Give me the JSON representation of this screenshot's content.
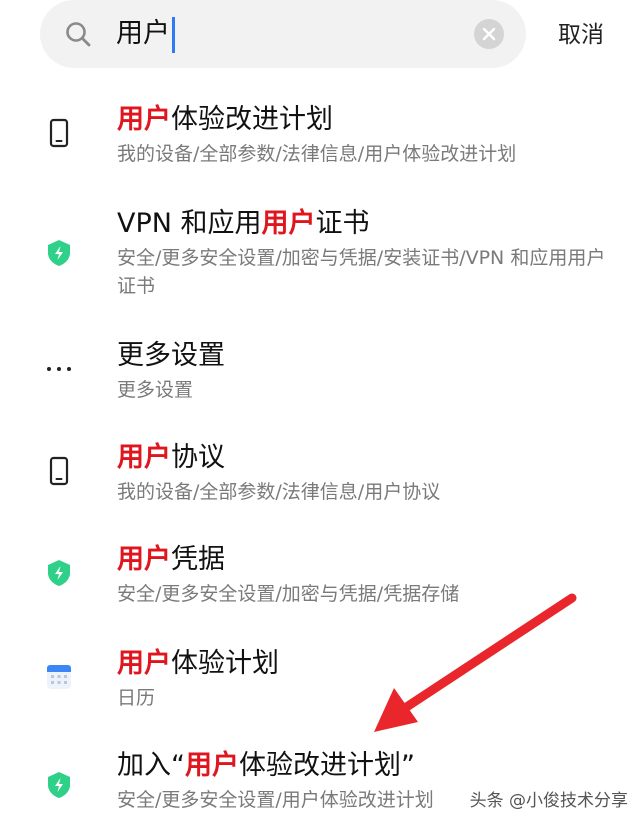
{
  "search": {
    "query": "用户",
    "cancel_label": "取消"
  },
  "results": [
    {
      "icon": "phone-icon",
      "title_pre": "",
      "title_hl": "用户",
      "title_post": "体验改进计划",
      "path": "我的设备/全部参数/法律信息/用户体验改进计划"
    },
    {
      "icon": "shield-icon",
      "title_pre": "VPN 和应用",
      "title_hl": "用户",
      "title_post": "证书",
      "path": "安全/更多安全设置/加密与凭据/安装证书/VPN 和应用用户证书"
    },
    {
      "icon": "more-dots-icon",
      "title_pre": "更多设置",
      "title_hl": "",
      "title_post": "",
      "path": "更多设置"
    },
    {
      "icon": "phone-icon",
      "title_pre": "",
      "title_hl": "用户",
      "title_post": "协议",
      "path": "我的设备/全部参数/法律信息/用户协议"
    },
    {
      "icon": "shield-icon",
      "title_pre": "",
      "title_hl": "用户",
      "title_post": "凭据",
      "path": "安全/更多安全设置/加密与凭据/凭据存储"
    },
    {
      "icon": "calendar-icon",
      "title_pre": "",
      "title_hl": "用户",
      "title_post": "体验计划",
      "path": "日历"
    },
    {
      "icon": "shield-icon",
      "title_pre": "加入“",
      "title_hl": "用户",
      "title_post": "体验改进计划”",
      "path": "安全/更多安全设置/用户体验改进计划"
    }
  ],
  "watermark": "头条 @小俊技术分享",
  "colors": {
    "highlight": "#e0161e",
    "shield": "#2fd189",
    "arrow": "#e8262b",
    "caret": "#2f7bf6"
  }
}
